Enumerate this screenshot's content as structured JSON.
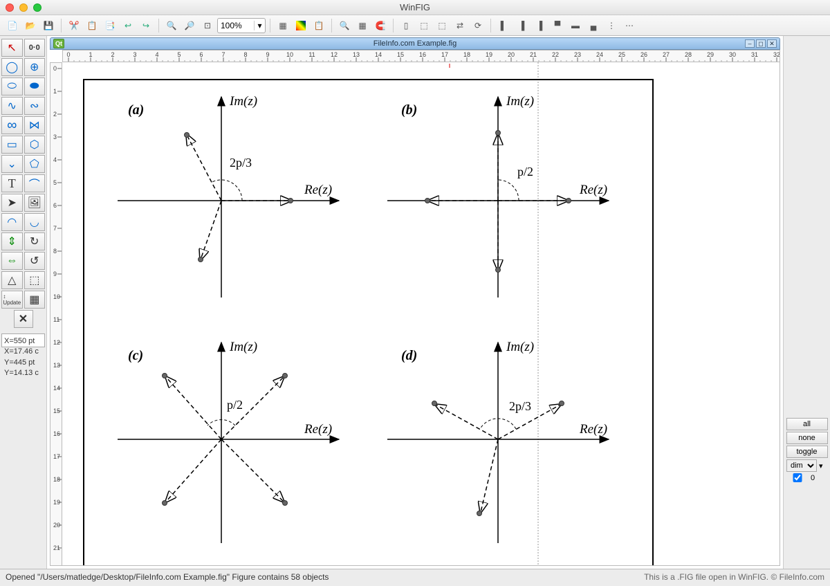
{
  "window": {
    "title": "WinFIG"
  },
  "document": {
    "title": "FileInfo.com Example.fig",
    "qt_badge": "Qt"
  },
  "zoom": {
    "value": "100%"
  },
  "coords": {
    "x_pt": "X=550 pt",
    "x_c": "X=17.46 c",
    "y_pt": "Y=445 pt",
    "y_c": "Y=14.13 c"
  },
  "diagrams": {
    "a": {
      "label": "(a)",
      "im": "Im(z)",
      "re": "Re(z)",
      "angle": "2p/3"
    },
    "b": {
      "label": "(b)",
      "im": "Im(z)",
      "re": "Re(z)",
      "angle": "p/2"
    },
    "c": {
      "label": "(c)",
      "im": "Im(z)",
      "re": "Re(z)",
      "angle": "p/2"
    },
    "d": {
      "label": "(d)",
      "im": "Im(z)",
      "re": "Re(z)",
      "angle": "2p/3"
    }
  },
  "right_panel": {
    "all": "all",
    "none": "none",
    "toggle": "toggle",
    "dim": "dim",
    "depth": "0"
  },
  "status": {
    "left": "Opened \"/Users/matledge/Desktop/FileInfo.com Example.fig\" Figure contains 58 objects",
    "right": "This is a .FIG file open in WinFIG. © FileInfo.com"
  },
  "toolbar_icons": [
    "new",
    "open",
    "save",
    "cut",
    "copy",
    "paste",
    "undo",
    "redo",
    "zoom-in",
    "zoom-out",
    "zoom-fit",
    "grid",
    "palette",
    "clipboard",
    "find",
    "grid2",
    "magnet",
    "layers",
    "group",
    "ungroup",
    "rotate",
    "flip",
    "align-left",
    "align-center",
    "align-right",
    "distribute-h",
    "distribute-v",
    "center-h",
    "center-v"
  ],
  "tools": [
    "pointer",
    "zoom-text",
    "ellipse",
    "ellipse-center",
    "circle",
    "circle-center",
    "arc-open",
    "arc-closed",
    "spline",
    "spline-closed",
    "rect",
    "polygon",
    "polyline",
    "polyline-closed",
    "text",
    "arc-tool",
    "arrow",
    "image",
    "circle2",
    "ellipse2",
    "move-v",
    "rotate-cw",
    "move-h",
    "rotate-ccw",
    "edit-point",
    "select-area",
    "update",
    "library",
    "delete"
  ]
}
